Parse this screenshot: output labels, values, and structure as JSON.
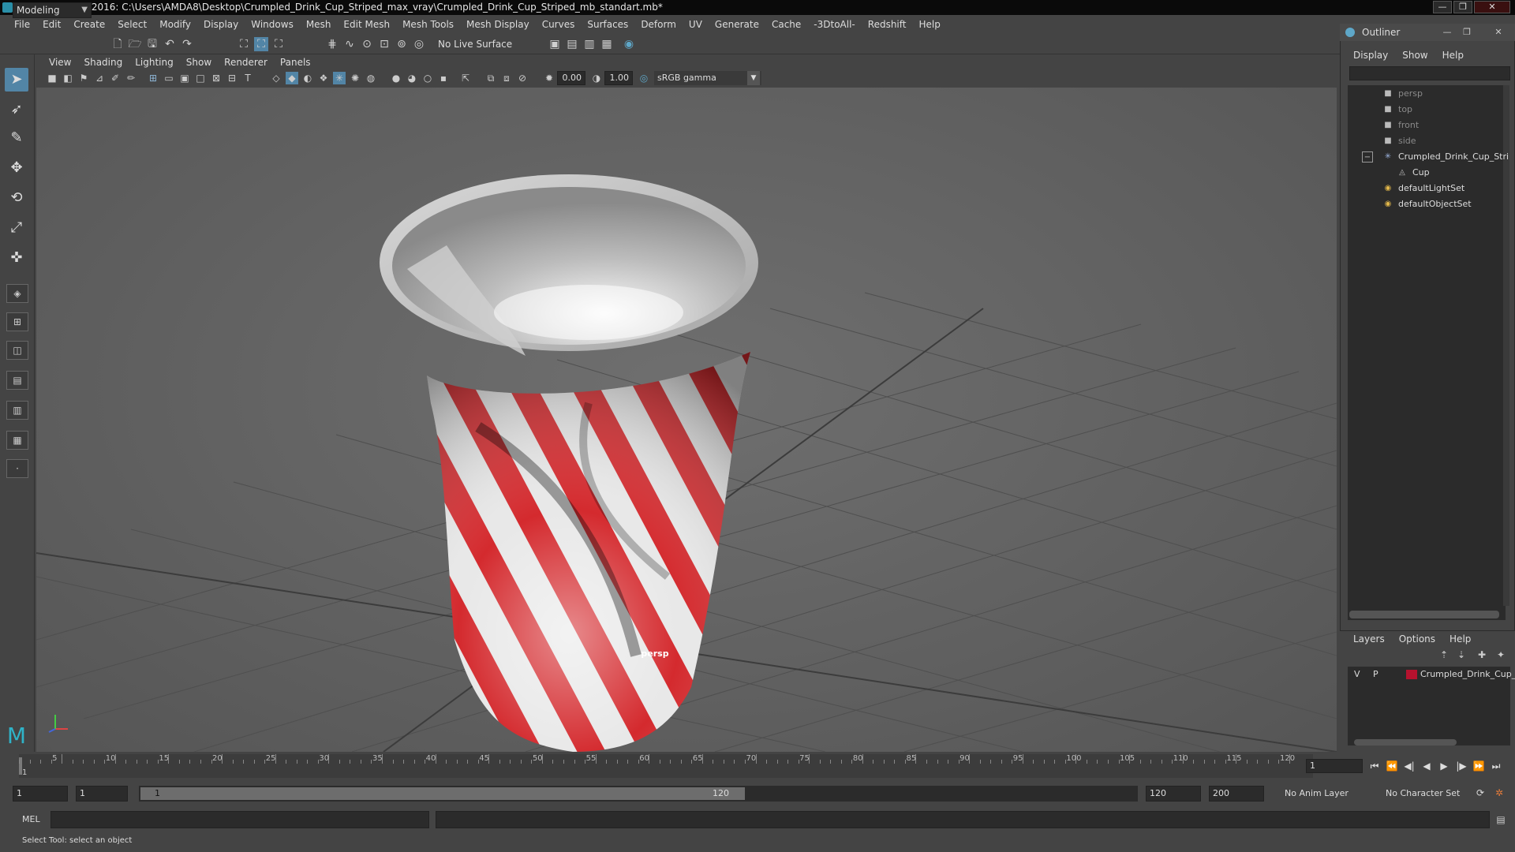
{
  "window": {
    "title": "Autodesk Maya 2016: C:\\Users\\AMDA8\\Desktop\\Crumpled_Drink_Cup_Striped_max_vray\\Crumpled_Drink_Cup_Striped_mb_standart.mb*",
    "controls": [
      "—",
      "❐",
      "✕"
    ]
  },
  "menubar": [
    "File",
    "Edit",
    "Create",
    "Select",
    "Modify",
    "Display",
    "Windows",
    "Mesh",
    "Edit Mesh",
    "Mesh Tools",
    "Mesh Display",
    "Curves",
    "Surfaces",
    "Deform",
    "UV",
    "Generate",
    "Cache",
    "-3DtoAll-",
    "Redshift",
    "Help"
  ],
  "statusline": {
    "mode": "Modeling",
    "live_surface": "No Live Surface"
  },
  "viewport": {
    "menu": [
      "View",
      "Shading",
      "Lighting",
      "Show",
      "Renderer",
      "Panels"
    ],
    "exposure": "0.00",
    "gamma": "1.00",
    "color_space": "sRGB gamma",
    "camera_label": "persp"
  },
  "outliner": {
    "title": "Outliner",
    "menu": [
      "Display",
      "Show",
      "Help"
    ],
    "items": [
      {
        "label": "persp",
        "icon": "camera-icon",
        "dim": true
      },
      {
        "label": "top",
        "icon": "camera-icon",
        "dim": true
      },
      {
        "label": "front",
        "icon": "camera-icon",
        "dim": true
      },
      {
        "label": "side",
        "icon": "camera-icon",
        "dim": true
      },
      {
        "label": "Crumpled_Drink_Cup_Stri",
        "icon": "group-icon",
        "dim": false
      },
      {
        "label": "Cup",
        "icon": "mesh-icon",
        "dim": false
      },
      {
        "label": "defaultLightSet",
        "icon": "set-icon",
        "dim": false
      },
      {
        "label": "defaultObjectSet",
        "icon": "set-icon",
        "dim": false
      }
    ]
  },
  "layers": {
    "menu": [
      "Layers",
      "Options",
      "Help"
    ],
    "row": {
      "v": "V",
      "p": "P",
      "name": "Crumpled_Drink_Cup_",
      "color": "#b5122e"
    }
  },
  "timeline": {
    "ticks": [
      "5",
      "10",
      "15",
      "20",
      "25",
      "30",
      "35",
      "40",
      "45",
      "50",
      "55",
      "60",
      "65",
      "70",
      "75",
      "80",
      "85",
      "90",
      "95",
      "100",
      "105",
      "110",
      "115",
      "120"
    ],
    "start_tick": "1",
    "current_frame": "1"
  },
  "range": {
    "start": "1",
    "playback_start": "1",
    "handle_start": "1",
    "handle_end": "120",
    "playback_end": "120",
    "end": "200",
    "anim_layer": "No Anim Layer",
    "character_set": "No Character Set"
  },
  "command": {
    "language": "MEL",
    "status": "Select Tool: select an object"
  },
  "colors": {
    "stripe_red": "#d42a2e",
    "stripe_white": "#e8e8e8",
    "accent": "#5285a6"
  }
}
